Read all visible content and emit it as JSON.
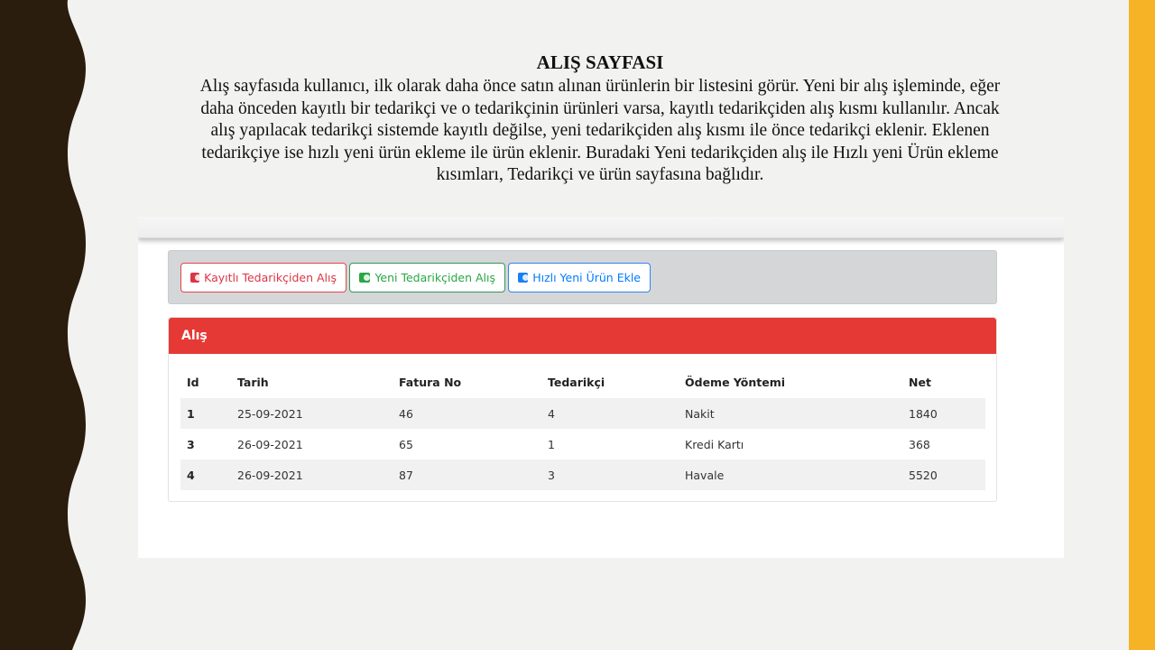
{
  "slide": {
    "title": "ALIŞ SAYFASI",
    "description_lines": [
      "Alış sayfasıda kullanıcı, ilk olarak daha önce satın alınan ürünlerin bir listesini görür. Yeni bir alış işleminde, eğer",
      "daha önceden kayıtlı bir tedarikçi ve o tedarikçinin ürünleri varsa, kayıtlı tedarikçiden alış kısmı kullanılır. Ancak",
      "alış yapılacak tedarikçi sistemde kayıtlı değilse, yeni tedarikçiden alış kısmı ile önce tedarikçi eklenir. Eklenen",
      "tedarikçiye ise hızlı yeni ürün ekleme ile ürün eklenir. Buradaki Yeni tedarikçiden alış ile Hızlı yeni Ürün ekleme",
      "kısımları, Tedarikçi ve ürün sayfasına bağlıdır."
    ],
    "colors": {
      "left_band": "#2b1d0e",
      "right_band": "#f6b326",
      "background": "#f2f2f0"
    }
  },
  "toolbar": {
    "buttons": [
      {
        "label": "Kayıtlı Tedarikçiden Alış",
        "icon": "money-bill-icon",
        "color": "#dc3545"
      },
      {
        "label": "Yeni Tedarikçiden Alış",
        "icon": "money-bill-icon",
        "color": "#28a745"
      },
      {
        "label": "Hızlı Yeni Ürün Ekle",
        "icon": "money-bill-icon",
        "color": "#007bff"
      }
    ]
  },
  "card": {
    "title": "Alış",
    "header_color": "#e53935",
    "table": {
      "headers": [
        "Id",
        "Tarih",
        "Fatura No",
        "Tedarikçi",
        "Ödeme Yöntemi",
        "Net"
      ],
      "rows": [
        [
          "1",
          "25-09-2021",
          "46",
          "4",
          "Nakit",
          "1840"
        ],
        [
          "3",
          "26-09-2021",
          "65",
          "1",
          "Kredi Kartı",
          "368"
        ],
        [
          "4",
          "26-09-2021",
          "87",
          "3",
          "Havale",
          "5520"
        ]
      ]
    }
  }
}
